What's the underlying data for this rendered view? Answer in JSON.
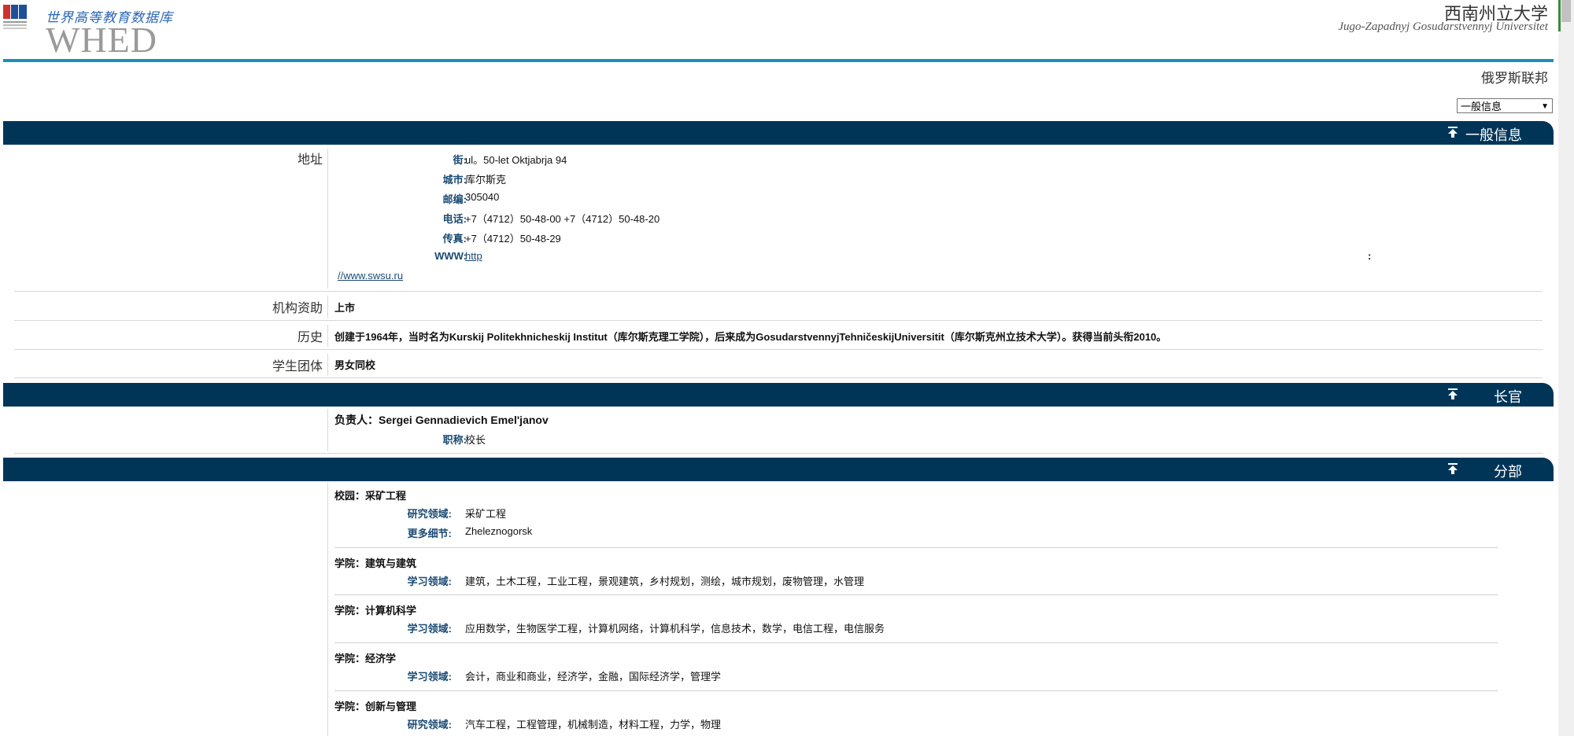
{
  "header": {
    "logo_tagline": "世界高等教育数据库",
    "logo_text": "WHED",
    "university_name_cn": "西南州立大学",
    "university_name_latin": "Jugo-Zapadnyj Gosudarstvennyj Universitet",
    "country": "俄罗斯联邦",
    "section_select": "一般信息"
  },
  "colors": {
    "bar": "#003557",
    "accent_line": "#1e90b8",
    "field_label": "#1a4a73"
  },
  "general": {
    "title": "一般信息",
    "address_label": "地址",
    "street_label": "街:",
    "street": "ul。50-let Oktjabrja 94",
    "city_label": "城市:",
    "city": "库尔斯克",
    "postcode_label": "邮编:",
    "postcode": "305040",
    "phone_label": "电话:",
    "phone": "+7（4712）50-48-00 +7（4712）50-48-20",
    "fax_label": "传真:",
    "fax": "+7（4712）50-48-29",
    "www_label": "WWW:",
    "www_part1": "http",
    "www_colon": ":",
    "www_part2": "//www.swsu.ru",
    "funding_label": "机构资助",
    "funding": "上市",
    "history_label": "历史",
    "history": "创建于1964年，当时名为Kurskij Politekhnicheskij Institut（库尔斯克理工学院），后来成为GosudarstvennyjTehničeskijUniversitit（库尔斯克州立技术大学）。获得当前头衔2010。",
    "student_body_label": "学生团体",
    "student_body": "男女同校"
  },
  "officers": {
    "title": "长官",
    "head": "负责人：Sergei Gennadievich Emel'janov",
    "job_title_label": "职称:",
    "job_title": "校长"
  },
  "divisions": {
    "title": "分部",
    "items": [
      {
        "heading": "校园：采矿工程",
        "f1_label": "研究领域:",
        "f1": "采矿工程",
        "f2_label": "更多细节:",
        "f2": "Zheleznogorsk"
      },
      {
        "heading": "学院：建筑与建筑",
        "f1_label": "学习领域:",
        "f1": "建筑，土木工程，工业工程，景观建筑，乡村规划，测绘，城市规划，废物管理，水管理"
      },
      {
        "heading": "学院：计算机科学",
        "f1_label": "学习领域:",
        "f1": "应用数学，生物医学工程，计算机网络，计算机科学，信息技术，数学，电信工程，电信服务"
      },
      {
        "heading": "学院：经济学",
        "f1_label": "学习领域:",
        "f1": "会计，商业和商业，经济学，金融，国际经济学，管理学"
      },
      {
        "heading": "学院：创新与管理",
        "f1_label": "研究领域:",
        "f1": "汽车工程，工程管理，机械制造，材料工程，力学，物理"
      }
    ]
  }
}
